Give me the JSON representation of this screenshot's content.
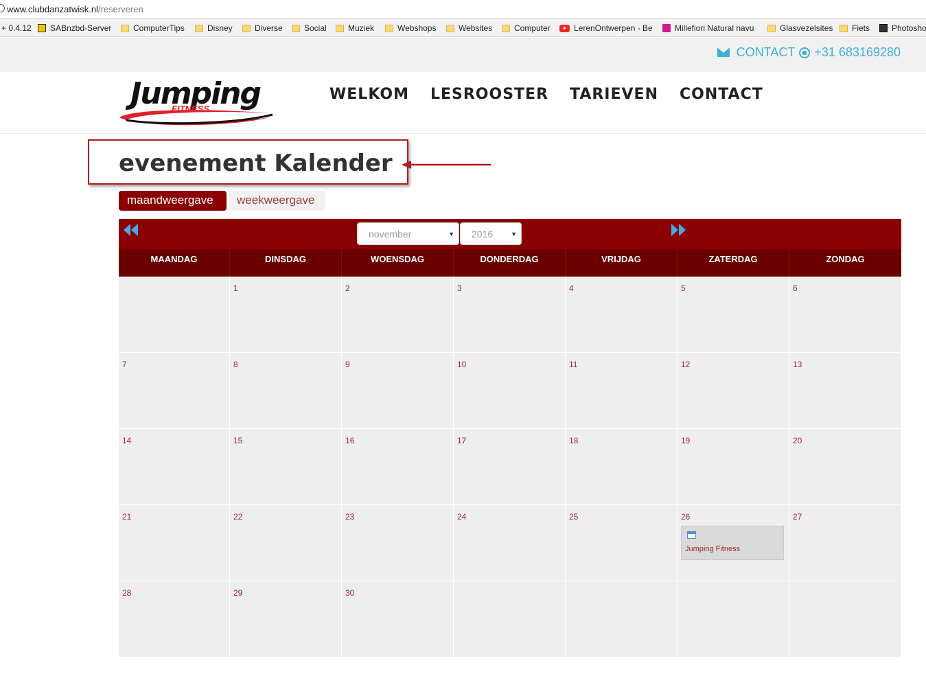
{
  "browser": {
    "url_host": "www.clubdanzatwisk.nl",
    "url_path": "/reserveren",
    "bookmarks": [
      {
        "label": "+ 0.4.12",
        "icon": "none"
      },
      {
        "label": "SABnzbd-Server",
        "icon": "sab-icon"
      },
      {
        "label": "ComputerTips",
        "icon": "folder-icon"
      },
      {
        "label": "Disney",
        "icon": "folder-icon"
      },
      {
        "label": "Diverse",
        "icon": "folder-icon"
      },
      {
        "label": "Social",
        "icon": "folder-icon"
      },
      {
        "label": "Muziek",
        "icon": "folder-icon"
      },
      {
        "label": "Webshops",
        "icon": "folder-icon"
      },
      {
        "label": "Websites",
        "icon": "folder-icon"
      },
      {
        "label": "Computer",
        "icon": "folder-icon"
      },
      {
        "label": "LerenOntwerpen - Be",
        "icon": "youtube-icon"
      },
      {
        "label": "Millefiori Natural navu",
        "icon": "bag-icon"
      },
      {
        "label": "Glasvezelsites",
        "icon": "folder-icon"
      },
      {
        "label": "Fiets",
        "icon": "folder-icon"
      },
      {
        "label": "Photoshop",
        "icon": "photoshop-icon"
      }
    ]
  },
  "topbar": {
    "contact_label": "CONTACT",
    "phone": "+31 683169280",
    "accent_color": "#3fb0d8"
  },
  "header": {
    "logo_word": "Jumping",
    "logo_sub": "FITNESS",
    "nav": [
      "WELKOM",
      "LESROOSTER",
      "TARIEVEN",
      "CONTACT"
    ]
  },
  "page": {
    "title": "evenement Kalender",
    "views": [
      "maandweergave",
      "weekweergave"
    ],
    "active_view": "maandweergave"
  },
  "calendar": {
    "month": "november",
    "year": "2016",
    "weekdays": [
      "MAANDAG",
      "DINSDAG",
      "WOENSDAG",
      "DONDERDAG",
      "VRIJDAG",
      "ZATERDAG",
      "ZONDAG"
    ],
    "weeks": [
      [
        "",
        "1",
        "2",
        "3",
        "4",
        "5",
        "6"
      ],
      [
        "7",
        "8",
        "9",
        "10",
        "11",
        "12",
        "13"
      ],
      [
        "14",
        "15",
        "16",
        "17",
        "18",
        "19",
        "20"
      ],
      [
        "21",
        "22",
        "23",
        "24",
        "25",
        "26",
        "27"
      ],
      [
        "28",
        "29",
        "30",
        "",
        "",
        "",
        ""
      ]
    ],
    "events": [
      {
        "day": "26",
        "title": "Jumping Fitness"
      }
    ],
    "header_color": "#8b0000"
  }
}
